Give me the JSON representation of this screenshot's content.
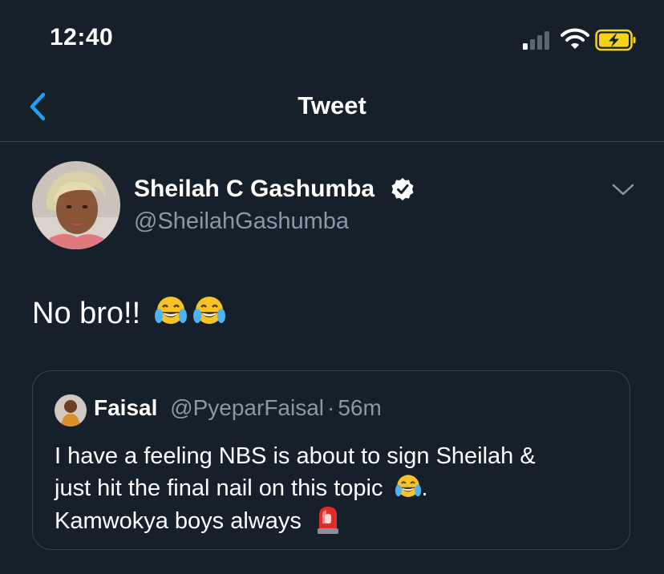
{
  "status_bar": {
    "time": "12:40",
    "signal_bars": 4,
    "signal_bars_active": 1,
    "battery_state": "charging",
    "battery_color": "#f7d21b"
  },
  "nav": {
    "back_icon": "chevron-left-icon",
    "title": "Tweet",
    "accent_color": "#1da1f2"
  },
  "tweet": {
    "author": {
      "name": "Sheilah C Gashumba",
      "handle": "@SheilahGashumba",
      "verified": true
    },
    "text": "No bro!!",
    "emojis": [
      "face-with-tears-of-joy",
      "face-with-tears-of-joy"
    ],
    "quoted": {
      "name": "Faisal",
      "handle": "@PyeparFaisal",
      "separator": "·",
      "time": "56m",
      "lines": [
        "I have a feeling NBS is about to sign Sheilah &",
        "just hit the final nail on this topic",
        "Kamwokya boys always"
      ],
      "line2_suffix": ".",
      "emojis": [
        "face-with-tears-of-joy",
        "police-car-light"
      ]
    }
  }
}
